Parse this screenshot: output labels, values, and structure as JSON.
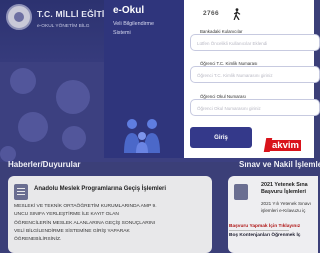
{
  "header": {
    "ministry_title": "T.C. MİLLİ EĞİTİM",
    "ministry_sub": "e-OKUL YÖNETİM BİLG"
  },
  "modal": {
    "title": "e-Okul",
    "subtitle_line1": "Veli Bilgilendirme",
    "subtitle_line2": "Sistemi",
    "id_text": "2766",
    "fields": [
      {
        "label": "Bankadaki Kulanıcılar",
        "placeholder": "Lütfen Öncelikli Kullanıcılar Eklendi"
      },
      {
        "label": "Öğrenci T.C. Kimlik Numarası",
        "placeholder": "Öğrenci T.C. Kimlik Numarasını giriniz"
      },
      {
        "label": "Öğrenci Okul Numarası",
        "placeholder": "Öğrenci Okul Numarasını giriniz"
      }
    ],
    "login_label": "Giriş",
    "watermark": "akvim"
  },
  "sections": {
    "left_title": "Haberler/Duyurular",
    "right_title": "Sınav ve Nakil İşlemleri"
  },
  "news": {
    "title": "Anadolu Meslek Programlarına Geçiş İşlemleri",
    "body": [
      "MESLEKİ VE TEKNİK ORTAÖĞRETİM KURUMLARINDA AMP 9.",
      "UNCU SINIFA YERLEŞTİRME İLE KAYIT OLAN",
      "ÖĞRENCİLERİN MESLEK ALANLARINA GEÇİŞ SONUÇLARINI",
      "VELİ BİLGİLENDİRME SİSTEMİNE GİRİŞ YAPARAK",
      "ÖĞRENEBİLİRSİNİZ."
    ]
  },
  "exam": {
    "title_line1": "2021 Yetenek Sına",
    "title_line2": "Başvuru İşlemleri",
    "line1": "2021 Yılı Yetenek Sınavı",
    "line2": "işlemleri e-Kılavuzu iç",
    "link": "Başvuru Yapmak İçin Tıklayınız",
    "link2": "Boş Kontenjanları Öğrenmek İç"
  },
  "colors": {
    "accent": "#34398a",
    "watermark": "#d9131b"
  }
}
